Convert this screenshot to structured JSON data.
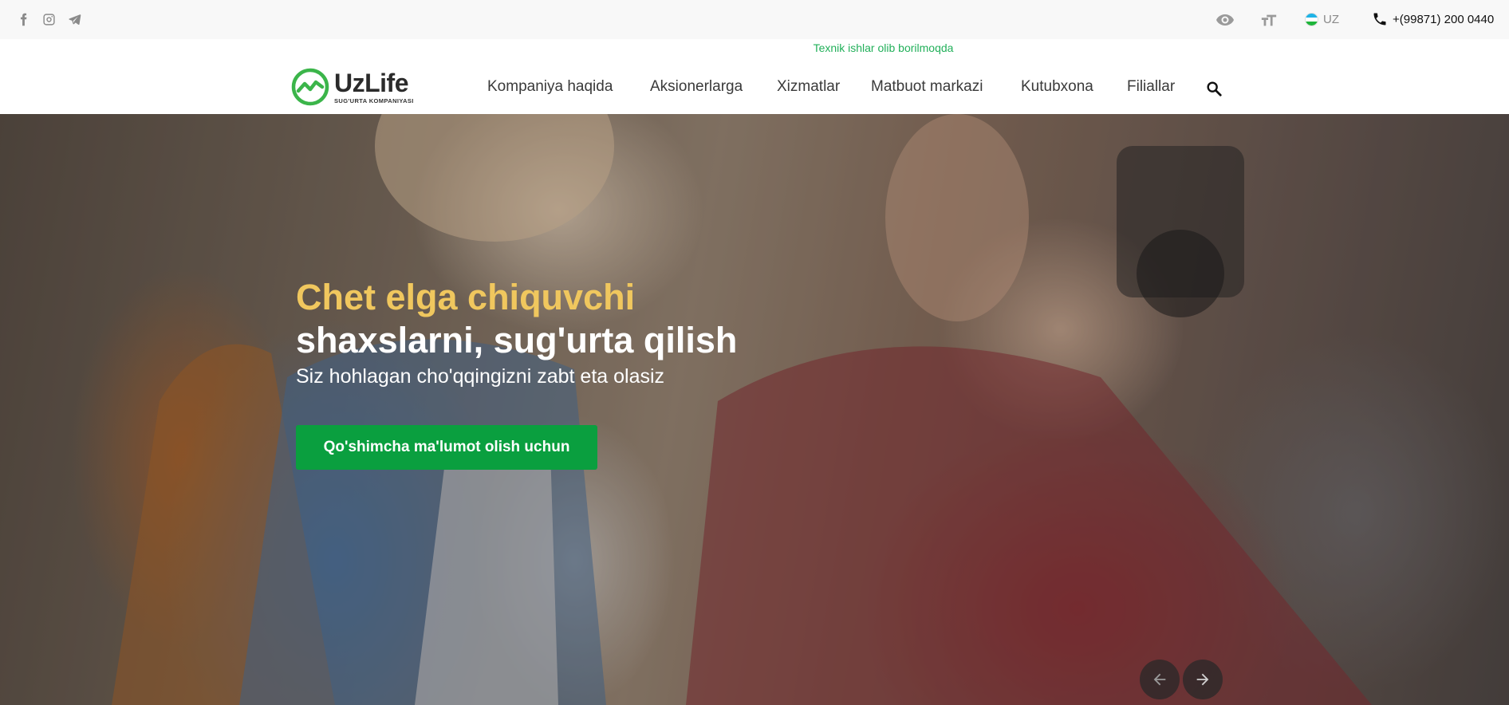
{
  "topbar": {
    "social": [
      "facebook-icon",
      "instagram-icon",
      "telegram-icon"
    ],
    "icons": [
      "eye-icon",
      "font-size-icon"
    ],
    "language": "UZ",
    "phone": "+(99871) 200 0440"
  },
  "header": {
    "notice": "Texnik ishlar olib borilmoqda",
    "logo": {
      "name": "UzLife",
      "tagline": "SUG'URTA KOMPANIYASI"
    },
    "nav": [
      "Kompaniya haqida",
      "Aksionerlarga",
      "Xizmatlar",
      "Matbuot markazi",
      "Kutubxona",
      "Filiallar"
    ]
  },
  "hero": {
    "title_line1": "Chet elga chiquvchi",
    "title_line2": "shaxslarni, sug'urta qilish",
    "subtitle": "Siz hohlagan cho'qqingizni zabt eta olasiz",
    "cta_label": "Qo'shimcha ma'lumot olish uchun"
  },
  "colors": {
    "brand_green": "#0a9f3f",
    "notice_green": "#22b05a",
    "title_yellow": "#f0c75e"
  }
}
